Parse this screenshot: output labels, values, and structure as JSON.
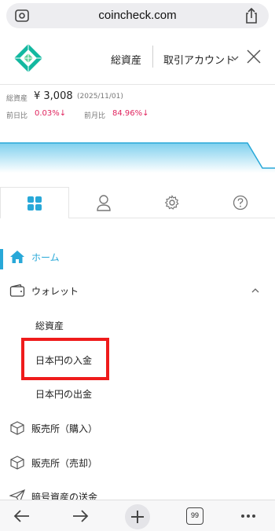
{
  "browser": {
    "url": "coincheck.com"
  },
  "header": {
    "nav_assets": "総資産",
    "nav_account": "取引アカウント"
  },
  "summary": {
    "total_label": "総資産",
    "total_value": "¥ 3,008",
    "date": "(2025/11/01)",
    "day_label": "前日比",
    "day_value": "0.03%↓",
    "month_label": "前月比",
    "month_value": "84.96%↓"
  },
  "colors": {
    "accent": "#28a8d8",
    "down": "#e0245e",
    "highlight": "#ef1b1b",
    "brand": "#13b8a0"
  },
  "tabs": [
    {
      "icon": "grid-icon",
      "active": true
    },
    {
      "icon": "user-icon",
      "active": false
    },
    {
      "icon": "gear-icon",
      "active": false
    },
    {
      "icon": "help-icon",
      "active": false
    }
  ],
  "menu": {
    "home": "ホーム",
    "wallet": "ウォレット",
    "wallet_items": [
      "総資産",
      "日本円の入金",
      "日本円の出金"
    ],
    "buy": "販売所（購入）",
    "sell": "販売所（売却）",
    "send": "暗号資産の送金"
  },
  "toolbar": {
    "tab_count": "99"
  }
}
